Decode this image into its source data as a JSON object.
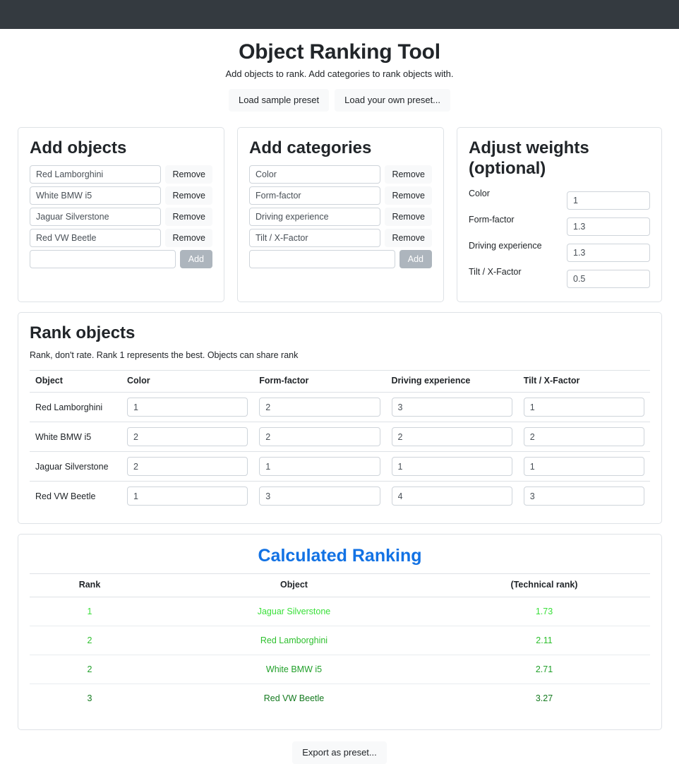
{
  "navbar": {
    "brand": ""
  },
  "header": {
    "title": "Object Ranking Tool",
    "subtitle": "Add objects to rank. Add categories to rank objects with.",
    "load_sample_label": "Load sample preset",
    "load_own_label": "Load your own preset..."
  },
  "objects_panel": {
    "title": "Add objects",
    "remove_label": "Remove",
    "add_label": "Add",
    "new_placeholder": "",
    "items": [
      {
        "value": "Red Lamborghini"
      },
      {
        "value": "White BMW i5"
      },
      {
        "value": "Jaguar Silverstone"
      },
      {
        "value": "Red VW Beetle"
      }
    ]
  },
  "categories_panel": {
    "title": "Add categories",
    "remove_label": "Remove",
    "add_label": "Add",
    "new_placeholder": "",
    "items": [
      {
        "value": "Color"
      },
      {
        "value": "Form-factor"
      },
      {
        "value": "Driving experience"
      },
      {
        "value": "Tilt / X-Factor"
      }
    ]
  },
  "weights_panel": {
    "title": "Adjust weights (optional)",
    "rows": [
      {
        "label": "Color",
        "value": "1"
      },
      {
        "label": "Form-factor",
        "value": "1.3"
      },
      {
        "label": "Driving experience",
        "value": "1.3"
      },
      {
        "label": "Tilt / X-Factor",
        "value": "0.5"
      }
    ]
  },
  "rank_section": {
    "title": "Rank objects",
    "subtitle": "Rank, don't rate. Rank 1 represents the best. Objects can share rank",
    "columns": [
      "Object",
      "Color",
      "Form-factor",
      "Driving experience",
      "Tilt / X-Factor"
    ],
    "rows": [
      {
        "object": "Red Lamborghini",
        "ranks": [
          "1",
          "2",
          "3",
          "1"
        ]
      },
      {
        "object": "White BMW i5",
        "ranks": [
          "2",
          "2",
          "2",
          "2"
        ]
      },
      {
        "object": "Jaguar Silverstone",
        "ranks": [
          "2",
          "1",
          "1",
          "1"
        ]
      },
      {
        "object": "Red VW Beetle",
        "ranks": [
          "1",
          "3",
          "4",
          "3"
        ]
      }
    ]
  },
  "result_section": {
    "title": "Calculated Ranking",
    "columns": [
      "Rank",
      "Object",
      "(Technical rank)"
    ],
    "rows": [
      {
        "rank": "1",
        "object": "Jaguar Silverstone",
        "technical": "1.73",
        "color": "#3ae03a"
      },
      {
        "rank": "2",
        "object": "Red Lamborghini",
        "technical": "2.11",
        "color": "#2ec02e"
      },
      {
        "rank": "2",
        "object": "White BMW i5",
        "technical": "2.71",
        "color": "#21a02a"
      },
      {
        "rank": "3",
        "object": "Red VW Beetle",
        "technical": "3.27",
        "color": "#147a1f"
      }
    ]
  },
  "footer": {
    "export_label": "Export as preset..."
  },
  "colors": {
    "navbar": "#343a40",
    "accent_blue": "#1272e4",
    "card_border": "#dee2e6",
    "muted_button": "#f8f9fa",
    "disabled_button": "#adb5bd"
  }
}
